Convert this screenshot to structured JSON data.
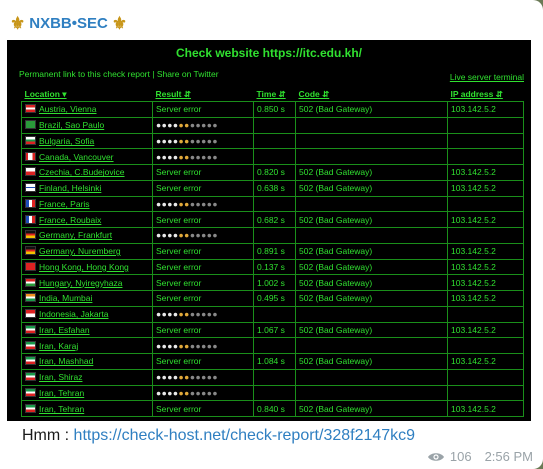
{
  "sender": {
    "name": "NXBB•SEC",
    "emblem": "⚜"
  },
  "screenshot": {
    "title": "Check website  https://itc.edu.kh/",
    "permalink": "Permanent link to this check report",
    "separator": " | ",
    "share": "Share on Twitter",
    "live_terminal": "Live server terminal",
    "headers": {
      "location": "Location ▾",
      "result": "Result ⇵",
      "time": "Time ⇵",
      "code": "Code ⇵",
      "ip": "IP address ⇵"
    },
    "rows": [
      {
        "flag": "at",
        "location": "Austria, Vienna",
        "result": "Server error",
        "time": "0.850 s",
        "code": "502 (Bad Gateway)",
        "ip": "103.142.5.2"
      },
      {
        "flag": "br",
        "location": "Brazil, Sao Paulo",
        "result": "",
        "time": "",
        "code": "",
        "ip": ""
      },
      {
        "flag": "bg",
        "location": "Bulgaria, Sofia",
        "result": "",
        "time": "",
        "code": "",
        "ip": ""
      },
      {
        "flag": "ca",
        "location": "Canada, Vancouver",
        "result": "",
        "time": "",
        "code": "",
        "ip": ""
      },
      {
        "flag": "cz",
        "location": "Czechia, C.Budejovice",
        "result": "Server error",
        "time": "0.820 s",
        "code": "502 (Bad Gateway)",
        "ip": "103.142.5.2"
      },
      {
        "flag": "fi",
        "location": "Finland, Helsinki",
        "result": "Server error",
        "time": "0.638 s",
        "code": "502 (Bad Gateway)",
        "ip": "103.142.5.2"
      },
      {
        "flag": "fr",
        "location": "France, Paris",
        "result": "",
        "time": "",
        "code": "",
        "ip": ""
      },
      {
        "flag": "fr",
        "location": "France, Roubaix",
        "result": "Server error",
        "time": "0.682 s",
        "code": "502 (Bad Gateway)",
        "ip": "103.142.5.2"
      },
      {
        "flag": "de",
        "location": "Germany, Frankfurt",
        "result": "",
        "time": "",
        "code": "",
        "ip": ""
      },
      {
        "flag": "de",
        "location": "Germany, Nuremberg",
        "result": "Server error",
        "time": "0.891 s",
        "code": "502 (Bad Gateway)",
        "ip": "103.142.5.2"
      },
      {
        "flag": "hk",
        "location": "Hong Kong, Hong Kong",
        "result": "Server error",
        "time": "0.137 s",
        "code": "502 (Bad Gateway)",
        "ip": "103.142.5.2"
      },
      {
        "flag": "hu",
        "location": "Hungary, Nyiregyhaza",
        "result": "Server error",
        "time": "1.002 s",
        "code": "502 (Bad Gateway)",
        "ip": "103.142.5.2"
      },
      {
        "flag": "in",
        "location": "India, Mumbai",
        "result": "Server error",
        "time": "0.495 s",
        "code": "502 (Bad Gateway)",
        "ip": "103.142.5.2"
      },
      {
        "flag": "id",
        "location": "Indonesia, Jakarta",
        "result": "",
        "time": "",
        "code": "",
        "ip": ""
      },
      {
        "flag": "ir",
        "location": "Iran, Esfahan",
        "result": "Server error",
        "time": "1.067 s",
        "code": "502 (Bad Gateway)",
        "ip": "103.142.5.2"
      },
      {
        "flag": "ir",
        "location": "Iran, Karaj",
        "result": "",
        "time": "",
        "code": "",
        "ip": ""
      },
      {
        "flag": "ir",
        "location": "Iran, Mashhad",
        "result": "Server error",
        "time": "1.084 s",
        "code": "502 (Bad Gateway)",
        "ip": "103.142.5.2"
      },
      {
        "flag": "ir",
        "location": "Iran, Shiraz",
        "result": "",
        "time": "",
        "code": "",
        "ip": ""
      },
      {
        "flag": "ir",
        "location": "Iran, Tehran",
        "result": "",
        "time": "",
        "code": "",
        "ip": ""
      },
      {
        "flag": "ir",
        "location": "Iran, Tehran",
        "result": "Server error",
        "time": "0.840 s",
        "code": "502 (Bad Gateway)",
        "ip": "103.142.5.2"
      }
    ]
  },
  "caption": {
    "prefix": "Hmm : ",
    "link": "https://check-host.net/check-report/328f2147kc9"
  },
  "meta": {
    "views": "106",
    "time": "2:56 PM"
  },
  "colors": {
    "terminal_green": "#30e030",
    "link_blue": "#2f7fc1",
    "background": "#6b7a56"
  },
  "icons": {
    "views": "eye-icon",
    "emblem": "fleur-de-lis-icon"
  }
}
